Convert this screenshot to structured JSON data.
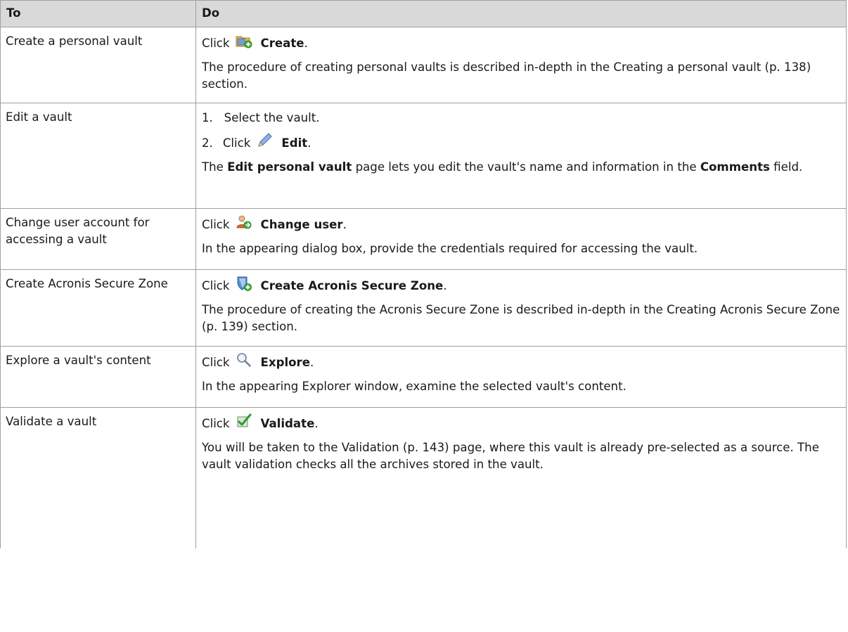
{
  "header": {
    "col_to": "To",
    "col_do": "Do"
  },
  "rows": [
    {
      "to": "Create a personal vault",
      "click_word": "Click",
      "icon": "create-folder-icon",
      "action": "Create",
      "note": "The procedure of creating personal vaults is described in-depth in the Creating a personal vault (p. 138) section."
    },
    {
      "to": "Edit a vault",
      "step1_num": "1.",
      "step1_text": "Select the vault.",
      "step2_num": "2.",
      "click_word": "Click",
      "icon": "pencil-icon",
      "action": "Edit",
      "note_a": "The",
      "note_b": "Edit personal vault",
      "note_c": "page lets you edit the vault's name and information in the",
      "note_d": "Comments",
      "note_e": "field."
    },
    {
      "to": "Change user account for accessing a vault",
      "click_word": "Click",
      "icon": "change-user-icon",
      "action": "Change user",
      "note": "In the appearing dialog box, provide the credentials required for accessing the vault."
    },
    {
      "to": "Create Acronis Secure Zone",
      "click_word": "Click",
      "icon": "secure-zone-shield-icon",
      "action": "Create Acronis Secure Zone",
      "note": "The procedure of creating the Acronis Secure Zone is described in-depth in the Creating Acronis Secure Zone (p. 139) section."
    },
    {
      "to": "Explore a vault's content",
      "click_word": "Click",
      "icon": "magnifier-icon",
      "action": "Explore",
      "note": "In the appearing Explorer window, examine the selected vault's content."
    },
    {
      "to": "Validate a vault",
      "click_word": "Click",
      "icon": "validate-check-icon",
      "action": "Validate",
      "note": "You will be taken to the Validation (p. 143) page, where this vault is already pre-selected as a source. The vault validation checks all the archives stored in the vault."
    }
  ],
  "punct": "."
}
